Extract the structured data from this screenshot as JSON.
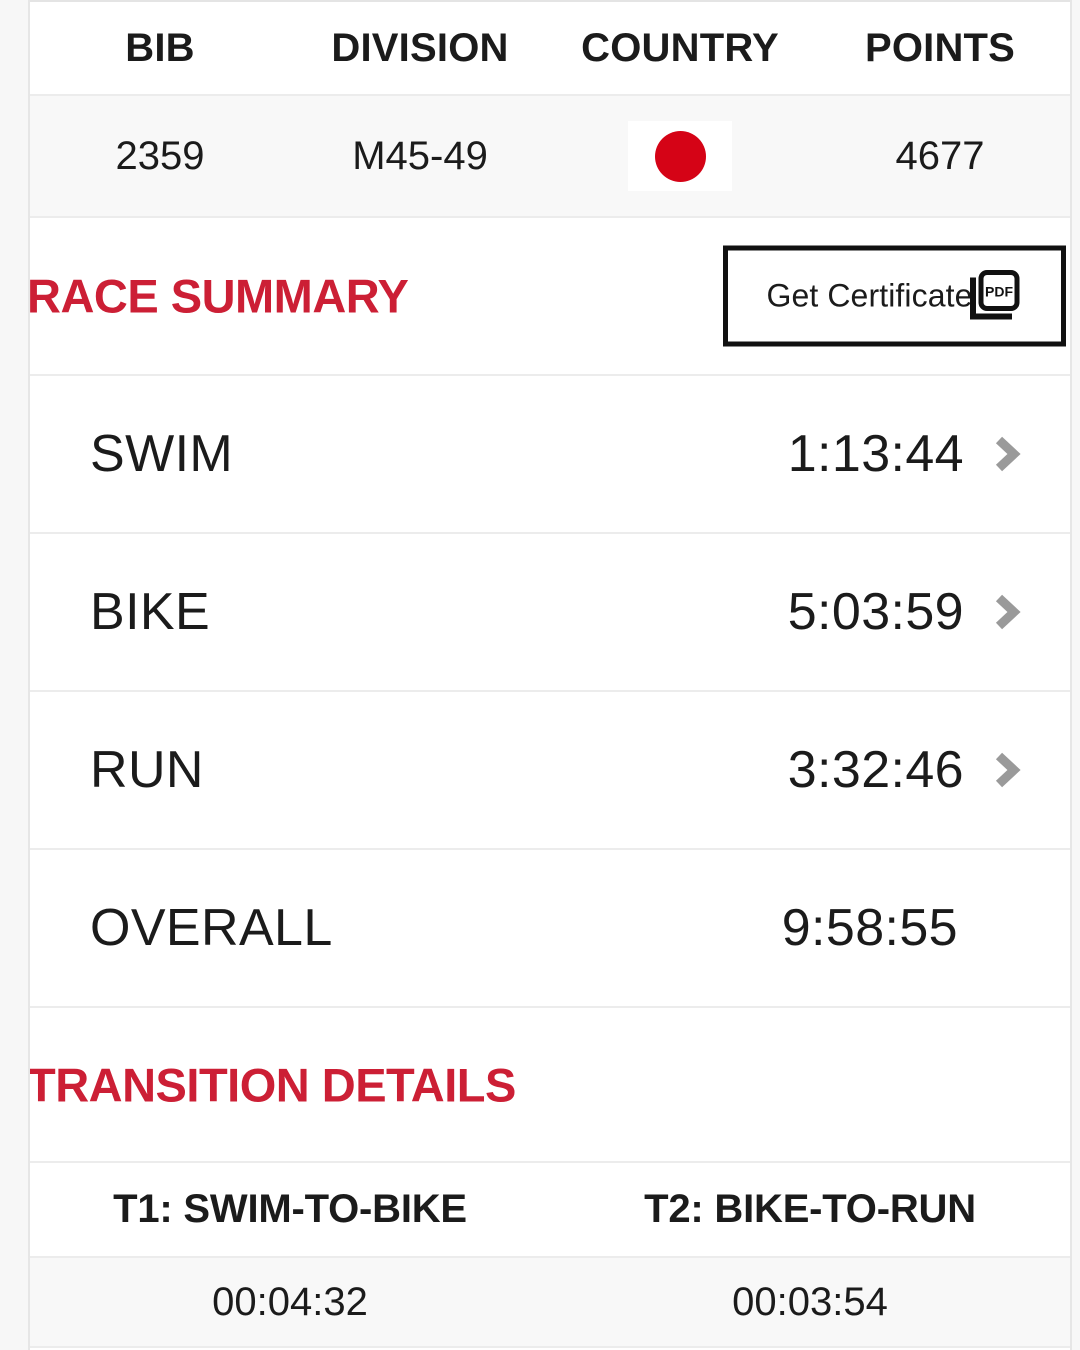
{
  "athlete_stats": {
    "headers": [
      "BIB",
      "DIVISION",
      "COUNTRY",
      "POINTS"
    ],
    "bib": "2359",
    "division": "M45-49",
    "country_flag": "japan-flag",
    "country_code": "JPN",
    "points": "4677"
  },
  "race_summary": {
    "title": "RACE SUMMARY",
    "certificate_button": {
      "label": "Get Certificate",
      "icon": "pdf-icon"
    },
    "splits": [
      {
        "label": "SWIM",
        "time": "1:13:44",
        "has_chevron": true
      },
      {
        "label": "BIKE",
        "time": "5:03:59",
        "has_chevron": true
      },
      {
        "label": "RUN",
        "time": "3:32:46",
        "has_chevron": true
      },
      {
        "label": "OVERALL",
        "time": "9:58:55",
        "has_chevron": false
      }
    ]
  },
  "transition_details": {
    "title": "TRANSITION DETAILS",
    "headers": [
      "T1: SWIM-TO-BIKE",
      "T2: BIKE-TO-RUN"
    ],
    "values": [
      "00:04:32",
      "00:03:54"
    ]
  },
  "colors": {
    "accent_red": "#cc1f35",
    "flag_red": "#d50316",
    "text": "#1b1b1b",
    "row_gray": "#f8f8f8",
    "border": "#ececec",
    "chevron_gray": "#9a9a9a"
  }
}
